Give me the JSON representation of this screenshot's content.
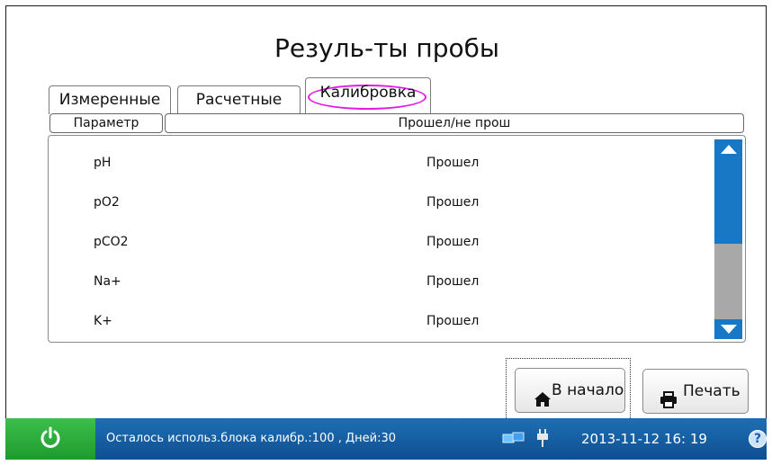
{
  "title": "Резуль-ты пробы",
  "tabs": [
    {
      "label": "Измеренные"
    },
    {
      "label": "Расчетные"
    },
    {
      "label": "Калибровка"
    }
  ],
  "table": {
    "headers": [
      "Параметр",
      "Прошел/не прош"
    ],
    "rows": [
      [
        "pH",
        "Прошел"
      ],
      [
        "pO2",
        "Прошел"
      ],
      [
        "pCO2",
        "Прошел"
      ],
      [
        "Na+",
        "Прошел"
      ],
      [
        "K+",
        "Прошел"
      ]
    ]
  },
  "buttons": {
    "home_label": "В начало",
    "print_label": "Печать"
  },
  "status": {
    "message": "Осталось использ.блока калибр.:100 , Дней:30",
    "datetime": "2013-11-12  16: 19",
    "help": "?"
  },
  "colors": {
    "accent_blue": "#1878c6",
    "statusbar": "#1d6fb6",
    "power_green": "#2fae3d",
    "highlight_oval": "#e21ae3"
  },
  "icons": [
    "home-icon",
    "printer-icon",
    "power-icon",
    "network-icon",
    "plug-icon",
    "help-icon"
  ]
}
